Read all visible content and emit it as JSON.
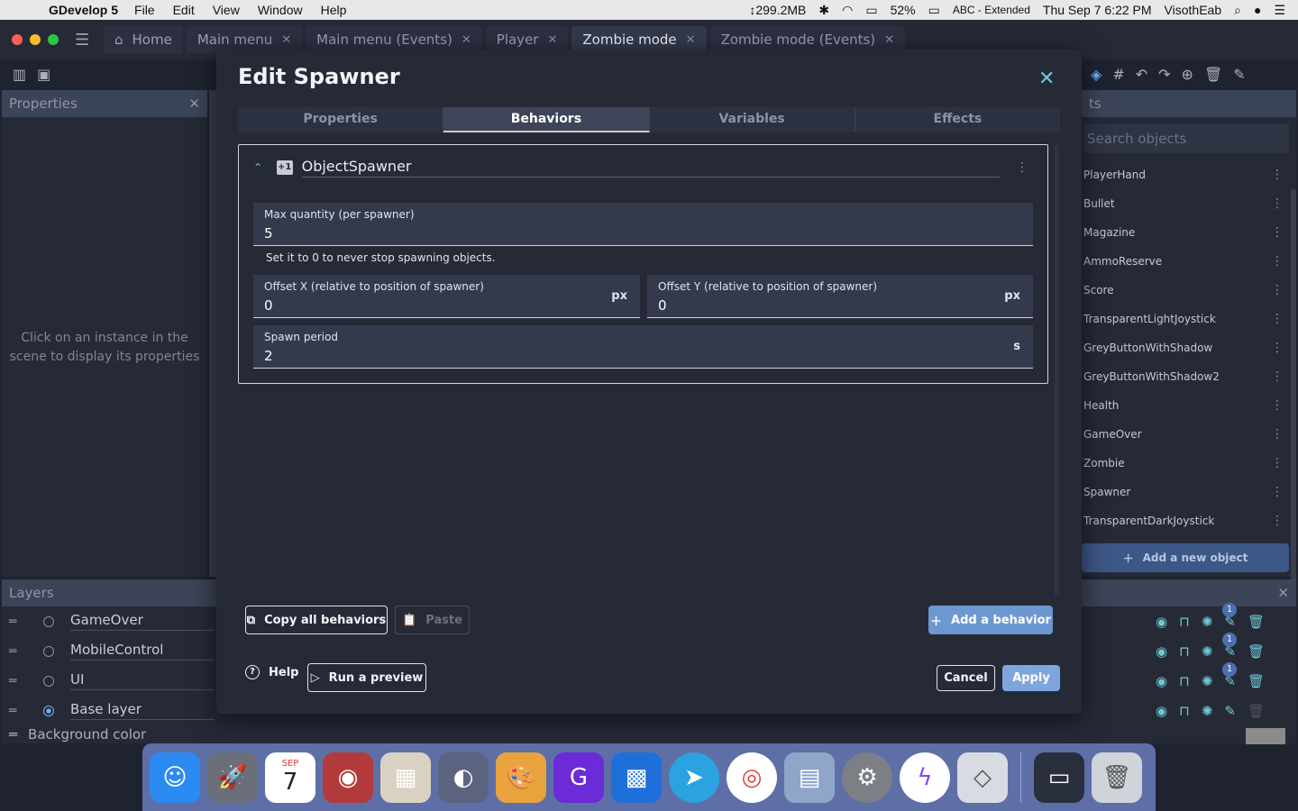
{
  "menubar": {
    "app_name": "GDevelop 5",
    "items": [
      "File",
      "Edit",
      "View",
      "Window",
      "Help"
    ],
    "memory": "↕299.2MB",
    "battery": "52%",
    "input_source": "ABC - Extended",
    "datetime": "Thu Sep 7  6:22 PM",
    "user": "VisothEab"
  },
  "tabs": [
    {
      "label": "Home"
    },
    {
      "label": "Main menu"
    },
    {
      "label": "Main menu (Events)"
    },
    {
      "label": "Player"
    },
    {
      "label": "Zombie mode"
    },
    {
      "label": "Zombie mode (Events)"
    }
  ],
  "left_panel": {
    "title": "Properties",
    "hint": "Click on an instance in the scene to display its properties"
  },
  "right_panel": {
    "title": "ts",
    "search_placeholder": "Search objects",
    "objects": [
      "PlayerHand",
      "Bullet",
      "Magazine",
      "AmmoReserve",
      "Score",
      "TransparentLightJoystick",
      "GreyButtonWithShadow",
      "GreyButtonWithShadow2",
      "Health",
      "GameOver",
      "Zombie",
      "Spawner",
      "TransparentDarkJoystick"
    ],
    "add_object_label": "Add a new object"
  },
  "layers": {
    "title": "Layers",
    "rows": [
      {
        "name": "GameOver",
        "badge": "1"
      },
      {
        "name": "MobileControl",
        "badge": "1"
      },
      {
        "name": "UI",
        "badge": "1"
      },
      {
        "name": "Base layer",
        "badge": ""
      }
    ],
    "background_label": "Background color"
  },
  "dialog": {
    "title": "Edit Spawner",
    "tabs": [
      "Properties",
      "Behaviors",
      "Variables",
      "Effects"
    ],
    "active_tab": "Behaviors",
    "behavior": {
      "icon_text": "+1",
      "name": "ObjectSpawner",
      "fields": {
        "max_quantity": {
          "label": "Max quantity (per spawner)",
          "value": "5"
        },
        "help": "Set it to 0 to never stop spawning objects.",
        "offset_x": {
          "label": "Offset X (relative to position of spawner)",
          "value": "0",
          "unit": "px"
        },
        "offset_y": {
          "label": "Offset Y (relative to position of spawner)",
          "value": "0",
          "unit": "px"
        },
        "spawn_period": {
          "label": "Spawn period",
          "value": "2",
          "unit": "s"
        }
      }
    },
    "buttons": {
      "copy_all": "Copy all behaviors",
      "paste": "Paste",
      "add_behavior": "Add a behavior",
      "help": "Help",
      "run_preview": "Run a preview",
      "cancel": "Cancel",
      "apply": "Apply"
    }
  },
  "dock": {
    "calendar_month": "SEP",
    "calendar_day": "7"
  }
}
